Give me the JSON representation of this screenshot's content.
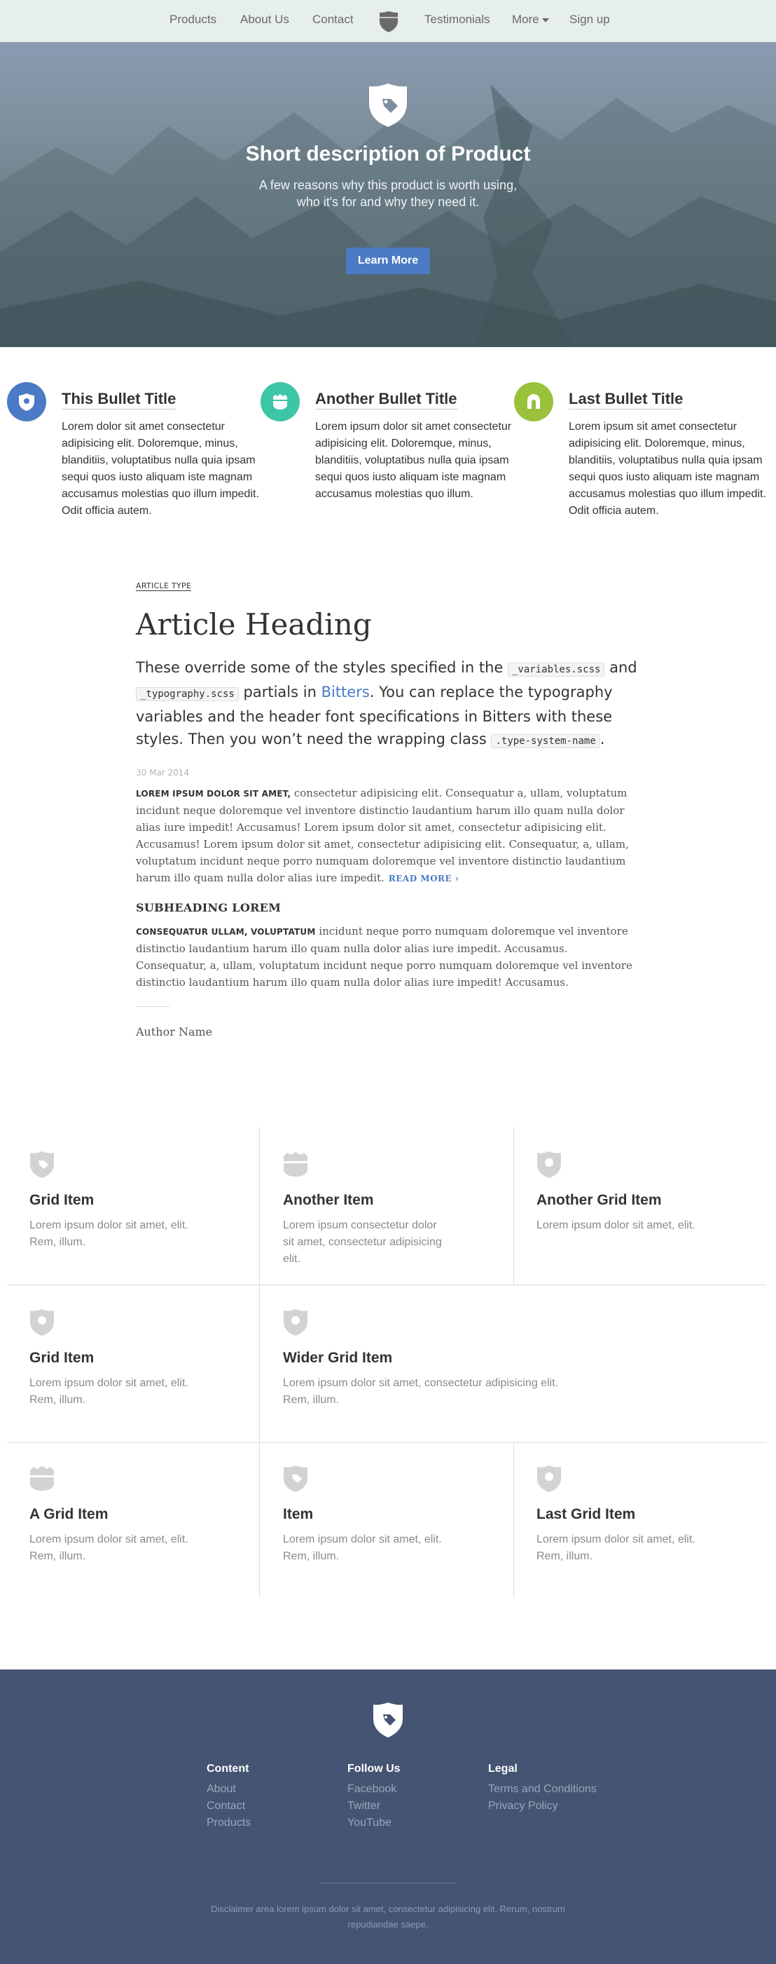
{
  "nav": {
    "items": [
      "Products",
      "About Us",
      "Contact",
      "Testimonials",
      "More",
      "Sign up"
    ],
    "logo_icon": "shield-logo-icon"
  },
  "hero": {
    "title": "Short description of Product",
    "subtitle": "A few reasons why this product is worth using, who it's for and why they need it.",
    "button_label": "Learn More",
    "icon": "shield-tag-icon"
  },
  "bullets": [
    {
      "title": "This Bullet Title",
      "text": "Lorem dolor sit amet consectetur adipisicing elit. Doloremque, minus, blanditiis, voluptatibus nulla quia ipsam sequi quos iusto aliquam iste magnam accusamus molestias quo illum impedit. Odit officia autem.",
      "icon": "map-pin-icon",
      "color": "#4a7bc4"
    },
    {
      "title": "Another Bullet Title",
      "text": "Lorem ipsum dolor sit amet consectetur adipisicing elit. Doloremque, minus, blanditiis, voluptatibus nulla quia ipsam sequi quos iusto aliquam iste magnam accusamus molestias quo illum.",
      "icon": "badge-icon",
      "color": "#3cc6a6"
    },
    {
      "title": "Last Bullet Title",
      "text": "Lorem ipsum sit amet consectetur adipisicing elit. Doloremque, minus, blanditiis, voluptatibus nulla quia ipsam sequi quos iusto aliquam iste magnam accusamus molestias quo illum impedit. Odit officia autem.",
      "icon": "tag-icon",
      "color": "#99c23a"
    }
  ],
  "article": {
    "type": "ARTICLE TYPE",
    "heading": "Article Heading",
    "lead_1": "These override some of the styles specified in the ",
    "lead_code_1": "_variables.scss",
    "lead_2": " and ",
    "lead_code_2": "_typography.scss",
    "lead_3": " partials in ",
    "lead_link": "Bitters",
    "lead_4": ". You can replace the typography variables and the header font specifications in Bitters with these styles. Then you won’t need the wrapping class ",
    "lead_code_3": ".type-system-name",
    "lead_5": ".",
    "date": "30 Mar 2014",
    "p1_lead": "LOREM IPSUM DOLOR SIT AMET,",
    "p1_text": " consectetur adipisicing elit. Consequatur a, ullam, voluptatum incidunt neque doloremque vel inventore distinctio laudantium harum illo quam nulla dolor alias iure impedit! Accusamus! Lorem ipsum dolor sit amet, consectetur adipisicing elit. Accusamus! Lorem ipsum dolor sit amet, consectetur adipisicing elit. Consequatur, a, ullam, voluptatum incidunt neque porro numquam doloremque vel inventore distinctio laudantium harum illo quam nulla dolor alias iure impedit.",
    "read_more": "READ MORE",
    "subheading": "SUBHEADING LOREM",
    "p2_lead": "CONSEQUATUR ULLAM, VOLUPTATUM",
    "p2_text": " incidunt neque porro numquam doloremque vel inventore distinctio laudantium harum illo quam nulla dolor alias iure impedit. Accusamus. Consequatur, a, ullam, voluptatum incidunt neque porro numquam doloremque vel inventore distinctio laudantium harum illo quam nulla dolor alias iure impedit! Accusamus.",
    "author": "Author Name"
  },
  "grid": [
    {
      "title": "Grid Item",
      "text": "Lorem ipsum dolor sit amet, elit. Rem, illum.",
      "icon": "shield-tag-icon"
    },
    {
      "title": "Another Item",
      "text": "Lorem ipsum consectetur dolor sit amet, consectetur adipisicing elit.",
      "icon": "badge-icon"
    },
    {
      "title": "Another Grid Item",
      "text": "Lorem ipsum dolor sit amet, elit.",
      "icon": "map-pin-icon"
    },
    {
      "title": "Grid Item",
      "text": "Lorem ipsum dolor sit amet, elit. Rem, illum.",
      "icon": "map-pin-icon"
    },
    {
      "title": "Wider Grid Item",
      "text": "Lorem ipsum dolor sit amet, consectetur adipisicing elit. Rem, illum.",
      "icon": "map-pin-icon"
    },
    {
      "title": "A Grid Item",
      "text": "Lorem ipsum dolor sit amet, elit. Rem, illum.",
      "icon": "badge-icon"
    },
    {
      "title": "Item",
      "text": "Lorem ipsum dolor sit amet, elit. Rem, illum.",
      "icon": "shield-tag-icon"
    },
    {
      "title": "Last Grid Item",
      "text": "Lorem ipsum dolor sit amet, elit. Rem, illum.",
      "icon": "map-pin-icon"
    }
  ],
  "footer": {
    "columns": [
      {
        "heading": "Content",
        "links": [
          "About",
          "Contact",
          "Products"
        ]
      },
      {
        "heading": "Follow Us",
        "links": [
          "Facebook",
          "Twitter",
          "YouTube"
        ]
      },
      {
        "heading": "Legal",
        "links": [
          "Terms and Conditions",
          "Privacy Policy"
        ]
      }
    ],
    "disclaimer": "Disclaimer area lorem ipsum dolor sit amet, consectetur adipisicing elit. Rerum, nostrum repudiandae saepe.",
    "logo_icon": "shield-tag-icon"
  },
  "colors": {
    "accent": "#4a7bc4",
    "teal": "#3cc6a6",
    "lime": "#99c23a",
    "footer_bg": "#445472",
    "nav_bg": "#e6efe9"
  }
}
